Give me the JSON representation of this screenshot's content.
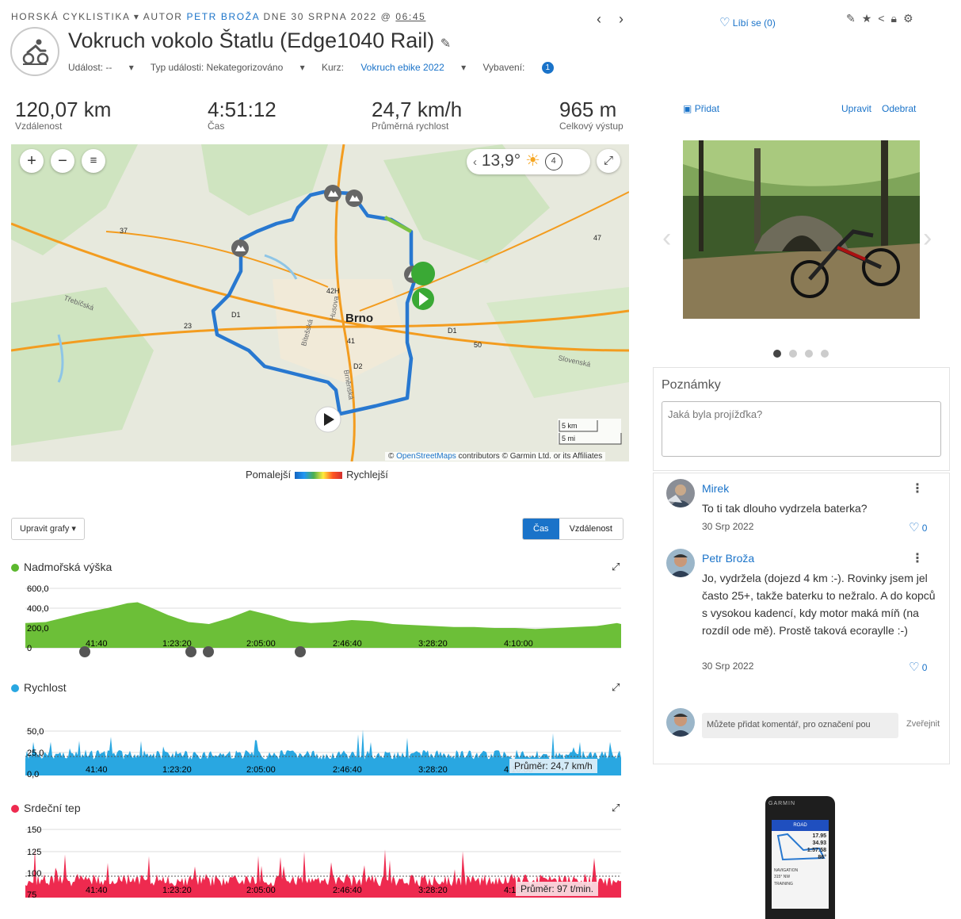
{
  "header": {
    "activity_type": "HORSKÁ CYKLISTIKA",
    "author_prefix": "AUTOR",
    "author": "PETR BROŽA",
    "date_prefix": "DNE 30 SRPNA 2022 @",
    "time": "06:45",
    "title": "Vokruch vokolo Štatlu (Edge1040 Rail)",
    "event_label": "Událost: --",
    "event_type_label": "Typ události: Nekategorizováno",
    "course_label": "Kurz:",
    "course_value": "Vokruch ebike 2022",
    "gear_label": "Vybavení:",
    "gear_count": "1",
    "like_label": "Líbí se (0)"
  },
  "stats": [
    {
      "value": "120,07 km",
      "label": "Vzdálenost"
    },
    {
      "value": "4:51:12",
      "label": "Čas"
    },
    {
      "value": "24,7 km/h",
      "label": "Průměrná rychlost"
    },
    {
      "value": "965 m",
      "label": "Celkový výstup"
    }
  ],
  "map": {
    "temperature": "13,9°",
    "wind": "4",
    "city": "Brno",
    "road_labels": [
      "37",
      "47",
      "42H",
      "D1",
      "23",
      "41",
      "D1",
      "50",
      "D2"
    ],
    "place_labels": [
      "Třebíčská",
      "Slovenská",
      "Brněnská",
      "Bítešská",
      "Husova"
    ],
    "scale_km": "5 km",
    "scale_mi": "5 mi",
    "attribution_prefix": "©",
    "attribution_link": "OpenStreetMaps",
    "attribution_rest": "contributors © Garmin Ltd. or its Affiliates",
    "legend_slow": "Pomalejší",
    "legend_fast": "Rychlejší"
  },
  "charts_controls": {
    "edit_label": "Upravit grafy ▾",
    "toggle_time": "Čas",
    "toggle_distance": "Vzdálenost"
  },
  "chart_data": [
    {
      "type": "area",
      "title": "Nadmořská výška",
      "color": "#5cb82e",
      "x_ticks": [
        "41:40",
        "1:23:20",
        "2:05:00",
        "2:46:40",
        "3:28:20",
        "4:10:00"
      ],
      "y_ticks": [
        "600,0",
        "400,0",
        "200,0",
        "0"
      ],
      "ylim": [
        0,
        600
      ],
      "x": [
        0,
        10,
        20,
        30,
        40,
        50,
        55,
        60,
        70,
        80,
        90,
        100,
        110,
        120,
        130,
        140,
        150,
        160,
        170,
        180,
        190,
        200,
        210,
        220,
        230,
        240,
        250,
        260,
        270,
        280,
        290,
        292
      ],
      "y": [
        250,
        260,
        310,
        360,
        400,
        450,
        460,
        420,
        330,
        260,
        240,
        300,
        380,
        330,
        270,
        250,
        260,
        280,
        270,
        240,
        230,
        220,
        210,
        210,
        200,
        200,
        190,
        200,
        210,
        220,
        250,
        240
      ]
    },
    {
      "type": "area",
      "title": "Rychlost",
      "color": "#29a7e1",
      "x_ticks": [
        "41:40",
        "1:23:20",
        "2:05:00",
        "2:46:40",
        "3:28:20",
        "4:10:00"
      ],
      "y_ticks": [
        "50,0",
        "25,0",
        "0,0"
      ],
      "ylim": [
        0,
        75
      ],
      "average_label": "Průměr: 24,7 km/h"
    },
    {
      "type": "area",
      "title": "Srdeční tep",
      "color": "#ee2a4f",
      "x_ticks": [
        "41:40",
        "1:23:20",
        "2:05:00",
        "2:46:40",
        "3:28:20",
        "4:10:00"
      ],
      "y_ticks": [
        "150",
        "125",
        "100",
        "75"
      ],
      "ylim": [
        75,
        150
      ],
      "average_label": "Průměr: 97 t/min."
    }
  ],
  "photos": {
    "add_label": "Přidat",
    "edit_label": "Upravit",
    "remove_label": "Odebrat"
  },
  "notes": {
    "title": "Poznámky",
    "placeholder": "Jaká byla projížďka?"
  },
  "comments": [
    {
      "name": "Mirek",
      "text": "To ti tak dlouho vydrzela baterka?",
      "date": "30 Srp 2022",
      "likes": "0"
    },
    {
      "name": "Petr Broža",
      "text": "Jo, vydržela (dojezd 4 km :-). Rovinky jsem jel často 25+, takže baterku to nežralo.  A do kopců s vysokou kadencí, kdy motor maká míň (na rozdíl ode mě). Prostě taková ecoraylle :-)",
      "date": "30 Srp 2022",
      "likes": "0"
    }
  ],
  "add_comment": {
    "placeholder": "Můžete přidat komentář, pro označení pou",
    "publish_label": "Zveřejnit"
  },
  "device": {
    "brand": "GARMIN",
    "screen_title": "ROAD",
    "values": [
      "17.95",
      "34.93",
      "1:57:58",
      "86°"
    ],
    "nav_label": "NAVIGATION",
    "nav_value": "315° NW",
    "training_label": "TRAINING"
  }
}
